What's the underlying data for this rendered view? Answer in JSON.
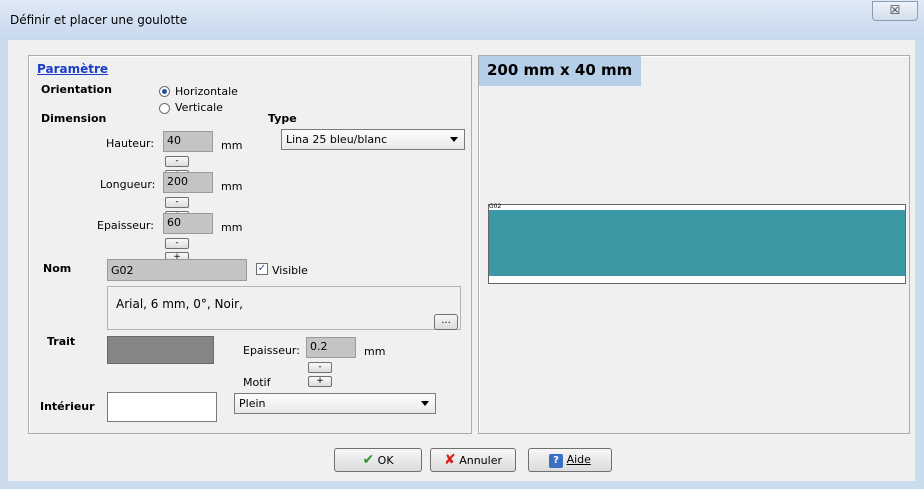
{
  "window": {
    "title": "Définir et placer une goulotte",
    "close_glyph": "☒"
  },
  "params": {
    "header": "Paramètre",
    "orientation_label": "Orientation",
    "orientation_options": [
      "Horizontale",
      "Verticale"
    ],
    "orientation_selected": "Horizontale",
    "dimension_label": "Dimension",
    "hauteur": {
      "label": "Hauteur:",
      "value": "40",
      "unit": "mm"
    },
    "longueur": {
      "label": "Longueur:",
      "value": "200",
      "unit": "mm"
    },
    "epaisseur": {
      "label": "Epaisseur:",
      "value": "60",
      "unit": "mm"
    },
    "stepper": {
      "minus": "-",
      "plus": "+"
    },
    "type_label": "Type",
    "type_value": "Lina 25 bleu/blanc",
    "nom_label": "Nom",
    "nom_value": "G02",
    "visible_label": "Visible",
    "visible_checked": true,
    "font_desc": "Arial, 6 mm, 0°, Noir,",
    "font_button": "...",
    "trait_label": "Trait",
    "trait_epaisseur_label": "Epaisseur:",
    "trait_epaisseur_value": "0.2",
    "trait_unit": "mm",
    "motif_label": "Motif",
    "motif_value": "Plein",
    "interieur_label": "Intérieur"
  },
  "preview": {
    "size_label": "200 mm x 40 mm",
    "code": "G02",
    "fill_color": "#3d98a6"
  },
  "buttons": {
    "ok": "OK",
    "annuler": "Annuler",
    "aide": "Aide"
  }
}
